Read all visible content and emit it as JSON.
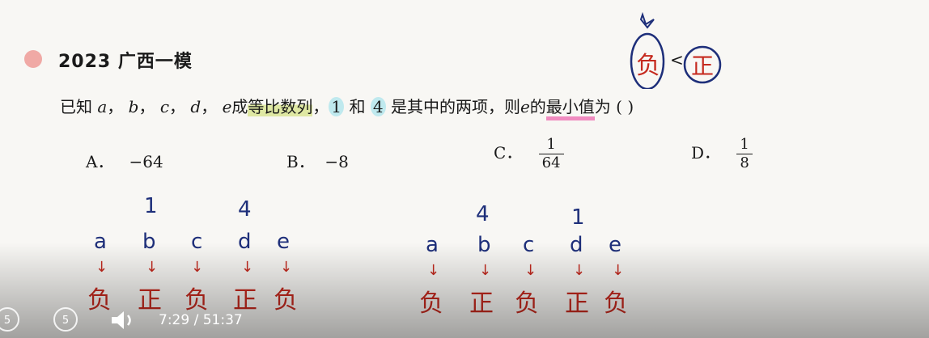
{
  "problem": {
    "year_region": "2023 广西一模",
    "q_part1": "已知",
    "vars": [
      "a",
      "b",
      "c",
      "d",
      "e"
    ],
    "q_part2": "成",
    "q_highlight": "等比数列",
    "q_part3": "，",
    "num1": "1",
    "q_part4": " 和 ",
    "num2": "4",
    "q_part5": " 是其中的两项，则",
    "var_e": "e",
    "q_part6": "的",
    "q_min": "最小值",
    "q_part7": "为 (        )",
    "options": [
      {
        "letter": "A",
        "text": "−64"
      },
      {
        "letter": "B",
        "text": "−8"
      },
      {
        "letter": "C",
        "num": "1",
        "den": "64"
      },
      {
        "letter": "D",
        "num": "1",
        "den": "8"
      }
    ]
  },
  "annotations": {
    "neg": "负",
    "pos": "正",
    "lt": "<",
    "left_group": {
      "letters": [
        "a",
        "b",
        "c",
        "d",
        "e"
      ],
      "above_b": "1",
      "above_d": "4",
      "signs": [
        "负",
        "正",
        "负",
        "正",
        "负"
      ]
    },
    "right_group": {
      "letters": [
        "a",
        "b",
        "c",
        "d",
        "e"
      ],
      "above_b": "4",
      "above_d": "1",
      "signs": [
        "负",
        "正",
        "负",
        "正",
        "负"
      ]
    }
  },
  "player": {
    "back_label": "5",
    "forward_label": "5",
    "time": "7:29 / 51:37"
  }
}
